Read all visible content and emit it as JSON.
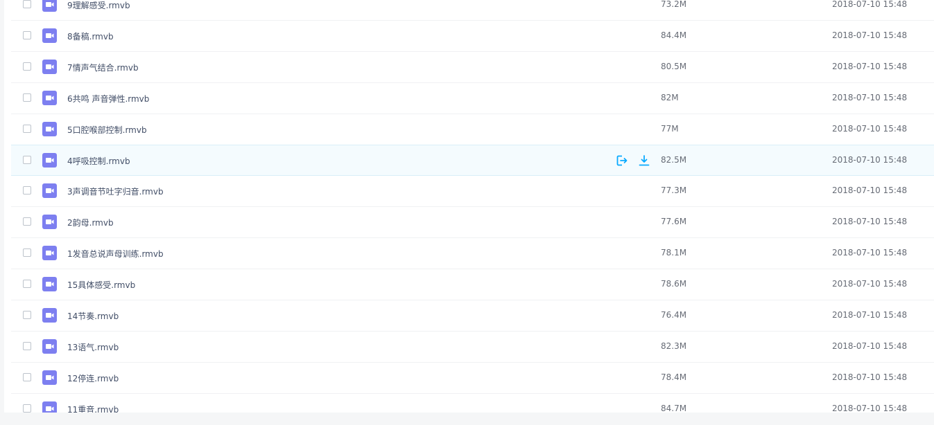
{
  "colors": {
    "accent": "#09aaff",
    "video_icon": "#7d7ff0",
    "hover_row": "#f4fbfe"
  },
  "files": [
    {
      "name": "9理解感受.rmvb",
      "size": "73.2M",
      "date": "2018-07-10 15:48",
      "icon": "video-file-icon"
    },
    {
      "name": "8备稿.rmvb",
      "size": "84.4M",
      "date": "2018-07-10 15:48",
      "icon": "video-file-icon"
    },
    {
      "name": "7情声气结合.rmvb",
      "size": "80.5M",
      "date": "2018-07-10 15:48",
      "icon": "video-file-icon"
    },
    {
      "name": "6共鸣 声音弹性.rmvb",
      "size": "82M",
      "date": "2018-07-10 15:48",
      "icon": "video-file-icon"
    },
    {
      "name": "5口腔喉部控制.rmvb",
      "size": "77M",
      "date": "2018-07-10 15:48",
      "icon": "video-file-icon"
    },
    {
      "name": "4呼吸控制.rmvb",
      "size": "82.5M",
      "date": "2018-07-10 15:48",
      "icon": "video-file-icon",
      "hovered": true,
      "actions": [
        "share-icon",
        "download-icon"
      ]
    },
    {
      "name": "3声调音节吐字归音.rmvb",
      "size": "77.3M",
      "date": "2018-07-10 15:48",
      "icon": "video-file-icon"
    },
    {
      "name": "2韵母.rmvb",
      "size": "77.6M",
      "date": "2018-07-10 15:48",
      "icon": "video-file-icon"
    },
    {
      "name": "1发音总说声母训练.rmvb",
      "size": "78.1M",
      "date": "2018-07-10 15:48",
      "icon": "video-file-icon"
    },
    {
      "name": "15具体感受.rmvb",
      "size": "78.6M",
      "date": "2018-07-10 15:48",
      "icon": "video-file-icon"
    },
    {
      "name": "14节奏.rmvb",
      "size": "76.4M",
      "date": "2018-07-10 15:48",
      "icon": "video-file-icon"
    },
    {
      "name": "13语气.rmvb",
      "size": "82.3M",
      "date": "2018-07-10 15:48",
      "icon": "video-file-icon"
    },
    {
      "name": "12停连.rmvb",
      "size": "78.4M",
      "date": "2018-07-10 15:48",
      "icon": "video-file-icon"
    },
    {
      "name": "11重音.rmvb",
      "size": "84.7M",
      "date": "2018-07-10 15:48",
      "icon": "video-file-icon"
    }
  ]
}
